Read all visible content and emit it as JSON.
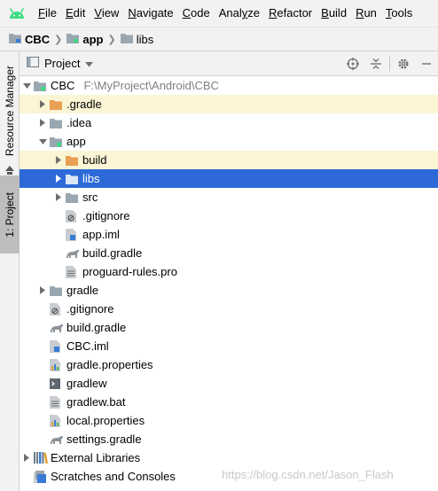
{
  "menu": {
    "items": [
      {
        "label": "File",
        "mnemonic": 0
      },
      {
        "label": "Edit",
        "mnemonic": 0
      },
      {
        "label": "View",
        "mnemonic": 0
      },
      {
        "label": "Navigate",
        "mnemonic": 0
      },
      {
        "label": "Code",
        "mnemonic": 0
      },
      {
        "label": "Analyze",
        "mnemonic": 4
      },
      {
        "label": "Refactor",
        "mnemonic": 0
      },
      {
        "label": "Build",
        "mnemonic": 0
      },
      {
        "label": "Run",
        "mnemonic": 0
      },
      {
        "label": "Tools",
        "mnemonic": 0
      }
    ]
  },
  "breadcrumb": [
    "CBC",
    "app",
    "libs"
  ],
  "left_strip": {
    "resource_manager": "Resource Manager",
    "project": "1: Project"
  },
  "tool_window": {
    "title": "Project"
  },
  "tree": [
    {
      "label": "CBC",
      "path": "F:\\MyProject\\Android\\CBC",
      "depth": 0,
      "arrow": "down",
      "icon": "module-folder-icon",
      "state": ""
    },
    {
      "label": ".gradle",
      "depth": 1,
      "arrow": "right",
      "icon": "folder-orange-icon",
      "state": "hl"
    },
    {
      "label": ".idea",
      "depth": 1,
      "arrow": "right",
      "icon": "folder-icon",
      "state": ""
    },
    {
      "label": "app",
      "depth": 1,
      "arrow": "down",
      "icon": "module-folder-icon",
      "state": ""
    },
    {
      "label": "build",
      "depth": 2,
      "arrow": "right",
      "icon": "folder-orange-icon",
      "state": "hl"
    },
    {
      "label": "libs",
      "depth": 2,
      "arrow": "right",
      "icon": "folder-icon",
      "state": "sel"
    },
    {
      "label": "src",
      "depth": 2,
      "arrow": "right",
      "icon": "folder-icon",
      "state": ""
    },
    {
      "label": ".gitignore",
      "depth": 2,
      "arrow": "",
      "icon": "gitignore-file-icon",
      "state": ""
    },
    {
      "label": "app.iml",
      "depth": 2,
      "arrow": "",
      "icon": "iml-file-icon",
      "state": ""
    },
    {
      "label": "build.gradle",
      "depth": 2,
      "arrow": "",
      "icon": "gradle-file-icon",
      "state": ""
    },
    {
      "label": "proguard-rules.pro",
      "depth": 2,
      "arrow": "",
      "icon": "text-file-icon",
      "state": ""
    },
    {
      "label": "gradle",
      "depth": 1,
      "arrow": "right",
      "icon": "folder-icon",
      "state": ""
    },
    {
      "label": ".gitignore",
      "depth": 1,
      "arrow": "",
      "icon": "gitignore-file-icon",
      "state": ""
    },
    {
      "label": "build.gradle",
      "depth": 1,
      "arrow": "",
      "icon": "gradle-file-icon",
      "state": ""
    },
    {
      "label": "CBC.iml",
      "depth": 1,
      "arrow": "",
      "icon": "iml-file-icon",
      "state": ""
    },
    {
      "label": "gradle.properties",
      "depth": 1,
      "arrow": "",
      "icon": "properties-file-icon",
      "state": ""
    },
    {
      "label": "gradlew",
      "depth": 1,
      "arrow": "",
      "icon": "terminal-file-icon",
      "state": ""
    },
    {
      "label": "gradlew.bat",
      "depth": 1,
      "arrow": "",
      "icon": "text-file-icon",
      "state": ""
    },
    {
      "label": "local.properties",
      "depth": 1,
      "arrow": "",
      "icon": "properties-file-icon",
      "state": ""
    },
    {
      "label": "settings.gradle",
      "depth": 1,
      "arrow": "",
      "icon": "gradle-file-icon",
      "state": ""
    },
    {
      "label": "External Libraries",
      "depth": 0,
      "arrow": "right",
      "icon": "library-icon",
      "state": ""
    },
    {
      "label": "Scratches and Consoles",
      "depth": 0,
      "arrow": "",
      "icon": "scratches-icon",
      "state": ""
    }
  ],
  "watermark": "https://blog.csdn.net/Jason_Flash",
  "colors": {
    "selection": "#2d6ad8",
    "excluded_highlight": "#fbf5d5",
    "folder": "#9aa7b0",
    "excluded_folder": "#e8a052",
    "android_green": "#3ddc84"
  }
}
